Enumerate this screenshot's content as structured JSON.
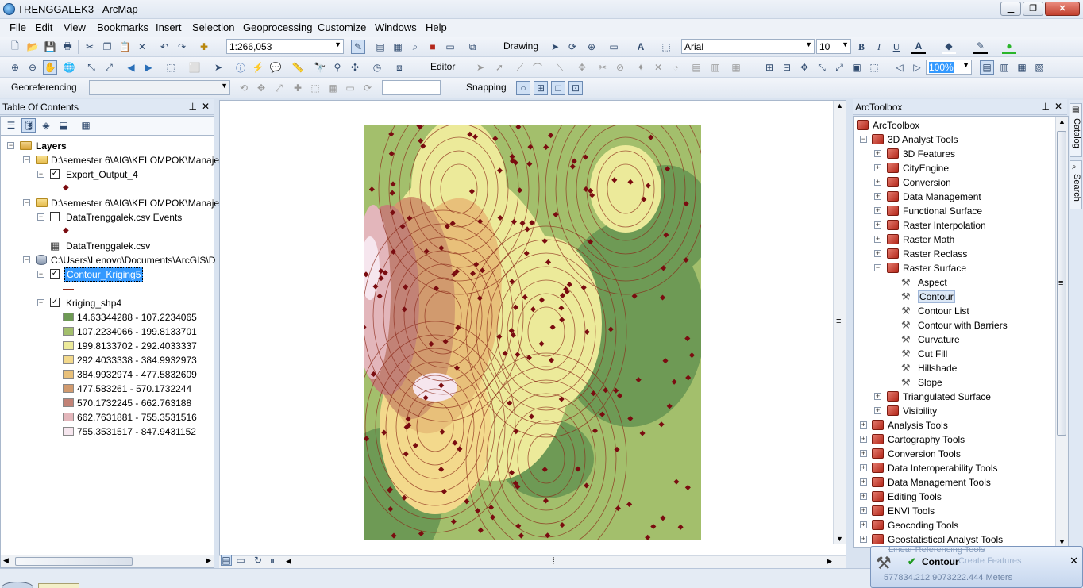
{
  "window": {
    "title": "TRENGGALEK3 - ArcMap",
    "minimize": "▁",
    "restore": "❐",
    "close": "✕"
  },
  "menu": [
    "File",
    "Edit",
    "View",
    "Bookmarks",
    "Insert",
    "Selection",
    "Geoprocessing",
    "Customize",
    "Windows",
    "Help"
  ],
  "toolbar": {
    "scale": "1:266,053",
    "drawing_label": "Drawing",
    "font": "Arial",
    "font_size": "10",
    "bold": "B",
    "italic": "I",
    "underline": "U",
    "editor_label": "Editor",
    "zoom_percent": "100%",
    "georef_label": "Georeferencing",
    "snapping_label": "Snapping"
  },
  "toc": {
    "title": "Table Of Contents",
    "root": "Layers",
    "items": [
      {
        "label": "D:\\semester 6\\AIG\\KELOMPOK\\Manaje"
      },
      {
        "label": "Export_Output_4",
        "checked": true
      },
      {
        "label": "D:\\semester 6\\AIG\\KELOMPOK\\Manaje"
      },
      {
        "label": "DataTrenggalek.csv Events",
        "checked": false
      },
      {
        "label": "DataTrenggalek.csv"
      },
      {
        "label": "C:\\Users\\Lenovo\\Documents\\ArcGIS\\D"
      },
      {
        "label": "Contour_Kriging5",
        "checked": true
      },
      {
        "label": "Kriging_shp4",
        "checked": true
      }
    ],
    "legend": [
      {
        "label": "14.63344288 - 107.2234065",
        "color": "#6e9a55"
      },
      {
        "label": "107.2234066 - 199.8133701",
        "color": "#a3bf6c"
      },
      {
        "label": "199.8133702 - 292.4033337",
        "color": "#ecea9a"
      },
      {
        "label": "292.4033338 - 384.9932973",
        "color": "#f3d98c"
      },
      {
        "label": "384.9932974 - 477.5832609",
        "color": "#e8c07a"
      },
      {
        "label": "477.583261 - 570.1732244",
        "color": "#d19a6e"
      },
      {
        "label": "570.1732245 - 662.763188",
        "color": "#c28276"
      },
      {
        "label": "662.7631881 - 755.3531516",
        "color": "#e3b6bb"
      },
      {
        "label": "755.3531517 - 847.9431152",
        "color": "#f6e6ee"
      }
    ]
  },
  "toolbox": {
    "title": "ArcToolbox",
    "root": "ArcToolbox",
    "items": [
      {
        "label": "3D Analyst Tools",
        "level": 0,
        "kind": "box",
        "exp": "−"
      },
      {
        "label": "3D Features",
        "level": 1,
        "kind": "box",
        "exp": "+"
      },
      {
        "label": "CityEngine",
        "level": 1,
        "kind": "box",
        "exp": "+"
      },
      {
        "label": "Conversion",
        "level": 1,
        "kind": "box",
        "exp": "+"
      },
      {
        "label": "Data Management",
        "level": 1,
        "kind": "box",
        "exp": "+"
      },
      {
        "label": "Functional Surface",
        "level": 1,
        "kind": "box",
        "exp": "+"
      },
      {
        "label": "Raster Interpolation",
        "level": 1,
        "kind": "box",
        "exp": "+"
      },
      {
        "label": "Raster Math",
        "level": 1,
        "kind": "box",
        "exp": "+"
      },
      {
        "label": "Raster Reclass",
        "level": 1,
        "kind": "box",
        "exp": "+"
      },
      {
        "label": "Raster Surface",
        "level": 1,
        "kind": "box",
        "exp": "−"
      },
      {
        "label": "Aspect",
        "level": 2,
        "kind": "tool"
      },
      {
        "label": "Contour",
        "level": 2,
        "kind": "tool",
        "selected": true
      },
      {
        "label": "Contour List",
        "level": 2,
        "kind": "tool"
      },
      {
        "label": "Contour with Barriers",
        "level": 2,
        "kind": "tool"
      },
      {
        "label": "Curvature",
        "level": 2,
        "kind": "tool"
      },
      {
        "label": "Cut Fill",
        "level": 2,
        "kind": "tool"
      },
      {
        "label": "Hillshade",
        "level": 2,
        "kind": "tool"
      },
      {
        "label": "Slope",
        "level": 2,
        "kind": "tool"
      },
      {
        "label": "Triangulated Surface",
        "level": 1,
        "kind": "box",
        "exp": "+"
      },
      {
        "label": "Visibility",
        "level": 1,
        "kind": "box",
        "exp": "+"
      },
      {
        "label": "Analysis Tools",
        "level": 0,
        "kind": "box",
        "exp": "+"
      },
      {
        "label": "Cartography Tools",
        "level": 0,
        "kind": "box",
        "exp": "+"
      },
      {
        "label": "Conversion Tools",
        "level": 0,
        "kind": "box",
        "exp": "+"
      },
      {
        "label": "Data Interoperability Tools",
        "level": 0,
        "kind": "box",
        "exp": "+"
      },
      {
        "label": "Data Management Tools",
        "level": 0,
        "kind": "box",
        "exp": "+"
      },
      {
        "label": "Editing Tools",
        "level": 0,
        "kind": "box",
        "exp": "+"
      },
      {
        "label": "ENVI Tools",
        "level": 0,
        "kind": "box",
        "exp": "+"
      },
      {
        "label": "Geocoding Tools",
        "level": 0,
        "kind": "box",
        "exp": "+"
      },
      {
        "label": "Geostatistical Analyst Tools",
        "level": 0,
        "kind": "box",
        "exp": "+"
      }
    ]
  },
  "side_tabs": {
    "catalog": "Catalog",
    "search": "Search"
  },
  "notification": {
    "title": "Contour",
    "behind_text": "Linear Referencing Tools",
    "behind_text2": "Create Features",
    "coordinates": "577834.212  9073222.444 Meters",
    "close": "✕"
  },
  "colors": {
    "low": "#6e9a55",
    "mid": "#ecea9a",
    "high": "#c28276",
    "peak": "#f6e6ee",
    "contour": "#8b2a1a",
    "point": "#7a0c10",
    "selection": "#3399ff"
  }
}
